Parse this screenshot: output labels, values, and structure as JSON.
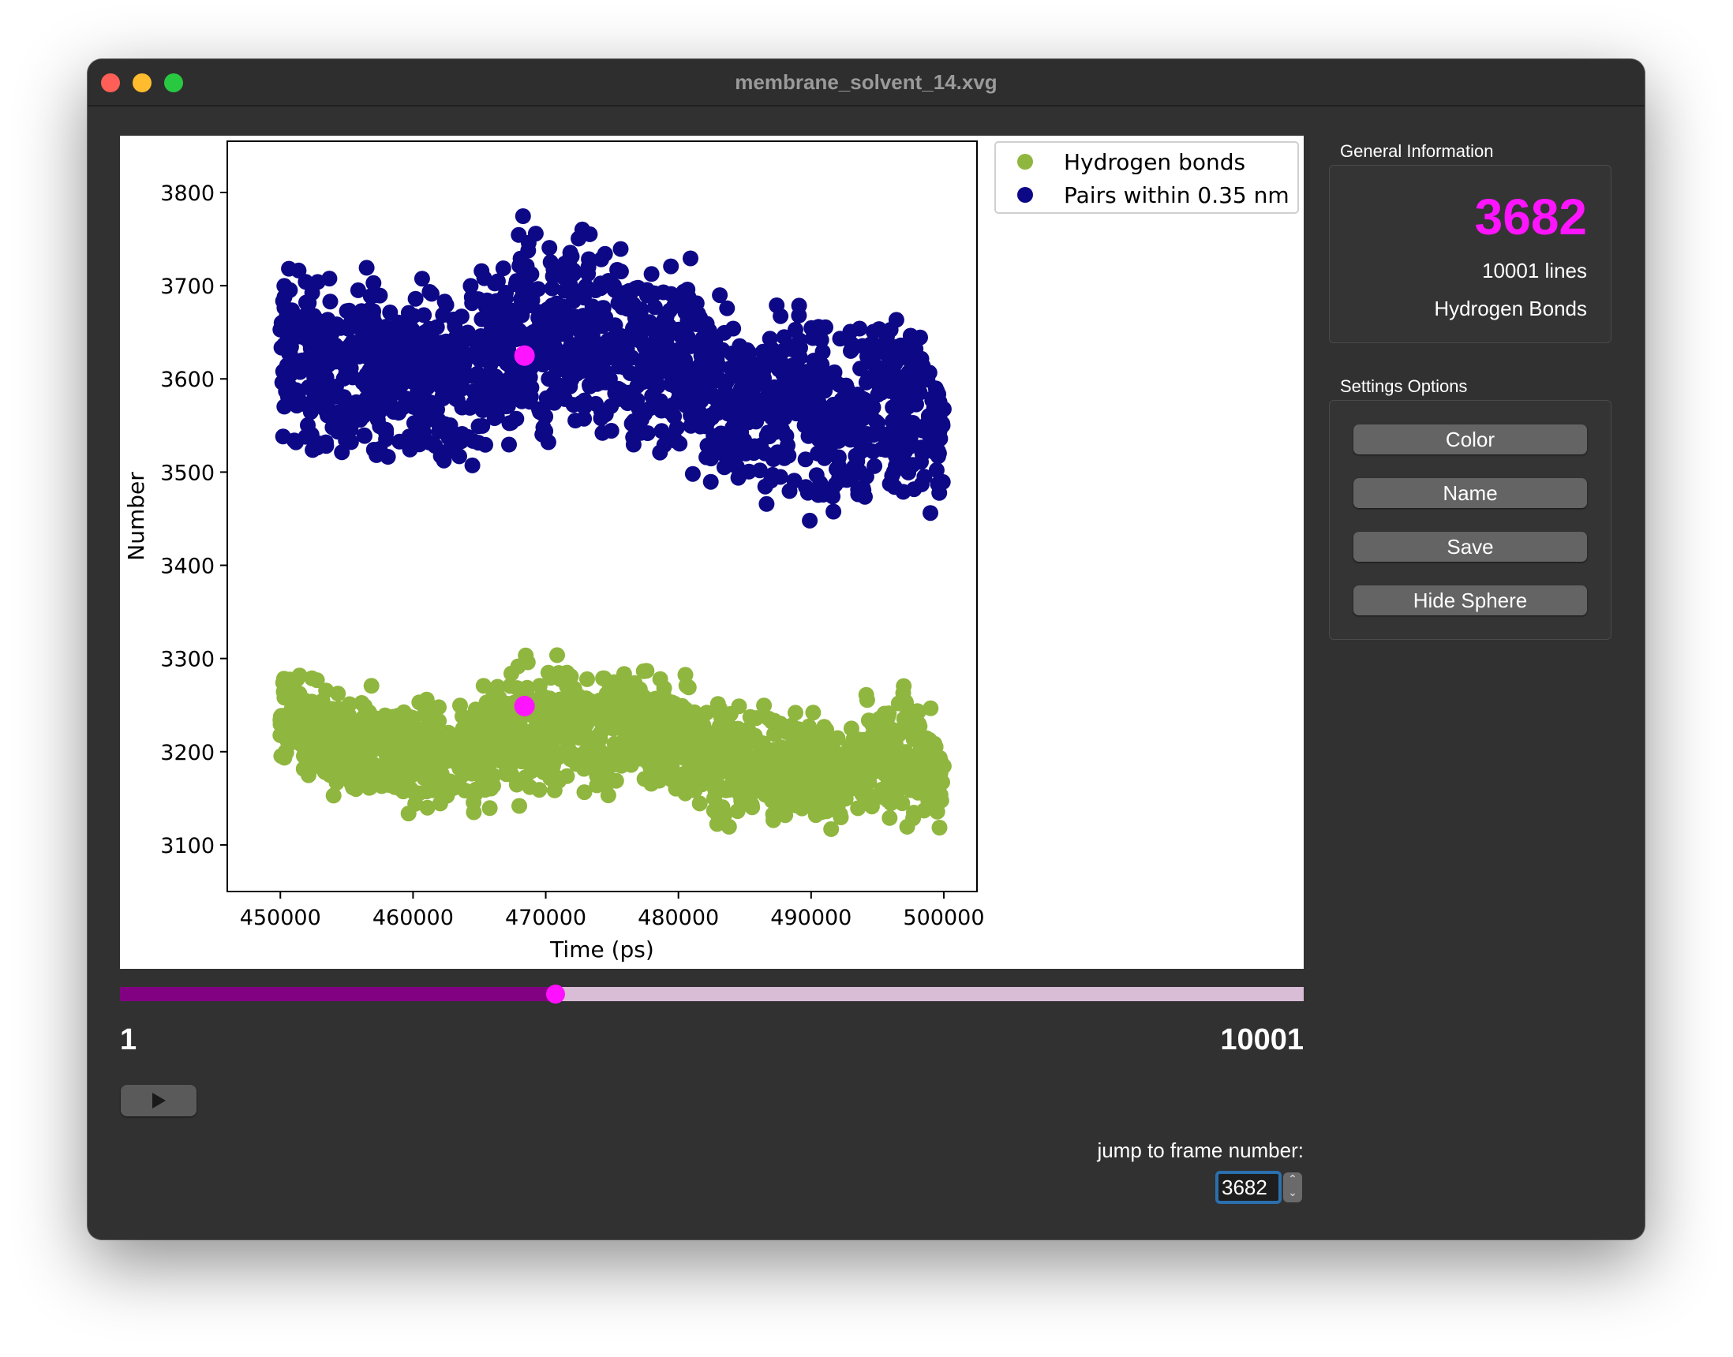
{
  "window": {
    "title": "membrane_solvent_14.xvg"
  },
  "chart_data": {
    "type": "scatter",
    "xlabel": "Time (ps)",
    "ylabel": "Number",
    "xlim": [
      446000,
      502500
    ],
    "ylim": [
      3050,
      3855
    ],
    "xticks": [
      450000,
      460000,
      470000,
      480000,
      490000,
      500000
    ],
    "yticks": [
      3100,
      3200,
      3300,
      3400,
      3500,
      3600,
      3700,
      3800
    ],
    "legend_position": "top-right",
    "grid": false,
    "series": [
      {
        "name": "Hydrogen bonds",
        "color": "#8fb63e",
        "envelope": {
          "x": [
            450000,
            453000,
            456000,
            459000,
            462000,
            465000,
            468000,
            471000,
            474000,
            477000,
            480000,
            483000,
            486000,
            489000,
            492000,
            495000,
            498000,
            500000
          ],
          "low": [
            3175,
            3150,
            3140,
            3130,
            3115,
            3120,
            3130,
            3145,
            3140,
            3150,
            3145,
            3110,
            3110,
            3105,
            3110,
            3120,
            3115,
            3100
          ],
          "high": [
            3300,
            3285,
            3280,
            3270,
            3265,
            3275,
            3310,
            3315,
            3300,
            3300,
            3290,
            3265,
            3260,
            3265,
            3235,
            3280,
            3285,
            3240
          ]
        }
      },
      {
        "name": "Pairs within 0.35 nm",
        "color": "#0d0886",
        "envelope": {
          "x": [
            450000,
            453000,
            456000,
            459000,
            462000,
            465000,
            468000,
            471000,
            474000,
            477000,
            480000,
            483000,
            486000,
            489000,
            492000,
            495000,
            498000,
            500000
          ],
          "low": [
            3510,
            3490,
            3475,
            3480,
            3470,
            3480,
            3520,
            3510,
            3505,
            3500,
            3500,
            3450,
            3440,
            3450,
            3420,
            3430,
            3440,
            3460
          ],
          "high": [
            3770,
            3720,
            3740,
            3730,
            3725,
            3730,
            3800,
            3790,
            3780,
            3760,
            3750,
            3710,
            3700,
            3710,
            3680,
            3710,
            3700,
            3650
          ]
        }
      }
    ],
    "current_frame": {
      "x": 468400,
      "hydrogen_bonds": 3249,
      "pairs": 3625,
      "marker_color": "#ff14ff"
    }
  },
  "slider": {
    "min_label": "1",
    "max_label": "10001",
    "min": 1,
    "max": 10001,
    "value": 3682
  },
  "controls": {
    "play_icon": "play-icon",
    "jump_label": "jump to frame number:",
    "jump_value": "3682"
  },
  "general_info": {
    "heading": "General Information",
    "frame_value": "3682",
    "lines_text": "10001 lines",
    "type_text": "Hydrogen Bonds"
  },
  "settings": {
    "heading": "Settings  Options",
    "buttons": [
      "Color",
      "Name",
      "Save",
      "Hide Sphere"
    ]
  }
}
